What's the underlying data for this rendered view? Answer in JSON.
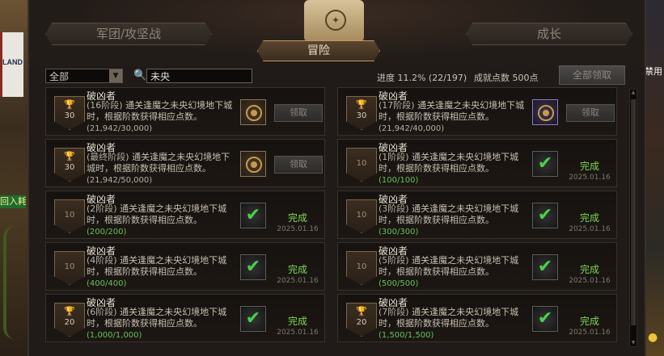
{
  "background": {
    "left_sign": "LAND",
    "left_badge": "回入耗",
    "right_text": "禁用 可以"
  },
  "tabs": {
    "left": "军团/攻坚战",
    "active": "冒险",
    "right": "成长"
  },
  "filter": {
    "category_value": "全部",
    "search_value": "未央"
  },
  "stats": {
    "progress_label": "进度  11.2% (22/197)",
    "points_label": "成就点数  500点"
  },
  "claim_all_label": "全部领取",
  "cards": [
    {
      "title": "破凶者",
      "stage": "(16阶段)",
      "desc": "通关逢魔之未央幻境地下城时，根据阶数获得相应点数。",
      "progress": "(21,942/30,000)",
      "points": "30",
      "cup": true,
      "reward": "emblem",
      "action": "领取",
      "done": false
    },
    {
      "title": "破凶者",
      "stage": "(17阶段)",
      "desc": "通关逢魔之未央幻境地下城时，根据阶数获得相应点数。",
      "progress": "(21,942/40,000)",
      "points": "30",
      "cup": true,
      "reward": "emblem-blue",
      "action": "领取",
      "done": false
    },
    {
      "title": "破凶者",
      "stage": "(最终阶段)",
      "desc": "通关逢魔之未央幻境地下城时，根据阶数获得相应点数。",
      "progress": "(21,942/50,000)",
      "points": "30",
      "cup": true,
      "reward": "emblem",
      "action": "领取",
      "done": false
    },
    {
      "title": "破凶者",
      "stage": "(1阶段)",
      "desc": "通关逢魔之未央幻境地下城时，根据阶数获得相应点数。",
      "progress": "(100/100)",
      "points": "10",
      "cup": false,
      "reward": "check",
      "action": "完成",
      "date": "2025.01.16",
      "done": true
    },
    {
      "title": "破凶者",
      "stage": "(2阶段)",
      "desc": "通关逢魔之未央幻境地下城时，根据阶数获得相应点数。",
      "progress": "(200/200)",
      "points": "10",
      "cup": false,
      "reward": "check",
      "action": "完成",
      "date": "2025.01.16",
      "done": true
    },
    {
      "title": "破凶者",
      "stage": "(3阶段)",
      "desc": "通关逢魔之未央幻境地下城时，根据阶数获得相应点数。",
      "progress": "(300/300)",
      "points": "10",
      "cup": false,
      "reward": "check",
      "action": "完成",
      "date": "2025.01.16",
      "done": true
    },
    {
      "title": "破凶者",
      "stage": "(4阶段)",
      "desc": "通关逢魔之未央幻境地下城时，根据阶数获得相应点数。",
      "progress": "(400/400)",
      "points": "10",
      "cup": false,
      "reward": "check",
      "action": "完成",
      "date": "2025.01.16",
      "done": true
    },
    {
      "title": "破凶者",
      "stage": "(5阶段)",
      "desc": "通关逢魔之未央幻境地下城时，根据阶数获得相应点数。",
      "progress": "(500/500)",
      "points": "10",
      "cup": false,
      "reward": "check",
      "action": "完成",
      "date": "2025.01.16",
      "done": true
    },
    {
      "title": "破凶者",
      "stage": "(6阶段)",
      "desc": "通关逢魔之未央幻境地下城时，根据阶数获得相应点数。",
      "progress": "(1,000/1,000)",
      "points": "20",
      "cup": true,
      "reward": "check",
      "action": "完成",
      "date": "2025.01.16",
      "done": true
    },
    {
      "title": "破凶者",
      "stage": "(7阶段)",
      "desc": "通关逢魔之未央幻境地下城时，根据阶数获得相应点数。",
      "progress": "(1,500/1,500)",
      "points": "20",
      "cup": true,
      "reward": "check",
      "action": "完成",
      "date": "2025.01.16",
      "done": true
    }
  ],
  "colors": {
    "done_green": "#7dd65a",
    "progress_green": "#64c35a",
    "gold_accent": "#c59b4a"
  }
}
